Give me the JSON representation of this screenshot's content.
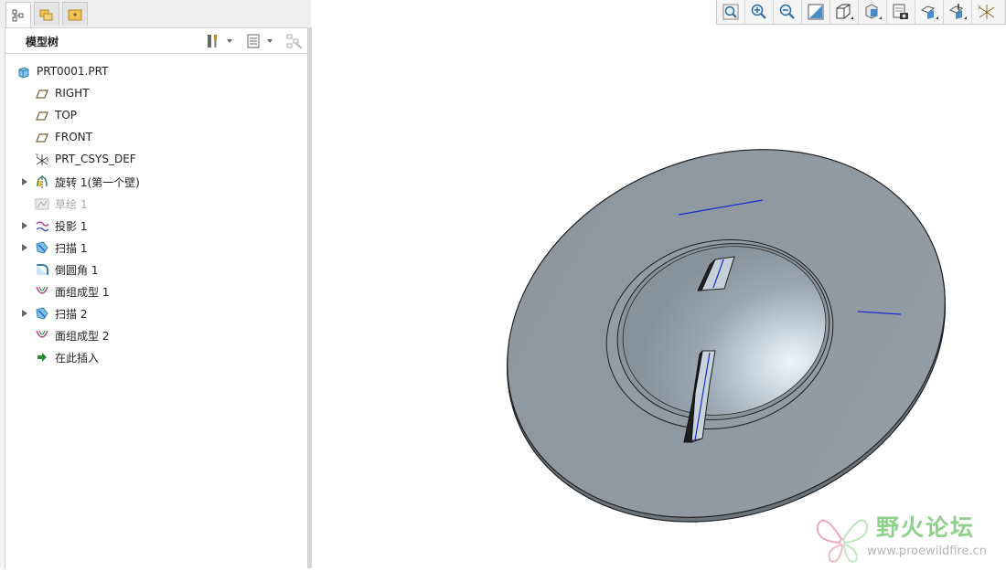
{
  "model_tree": {
    "title": "模型树",
    "items": [
      {
        "label": "PRT0001.PRT",
        "icon": "part-icon",
        "expandable": false,
        "disabled": false,
        "indent": 0
      },
      {
        "label": "RIGHT",
        "icon": "datum-plane-icon",
        "expandable": false,
        "disabled": false,
        "indent": 1
      },
      {
        "label": "TOP",
        "icon": "datum-plane-icon",
        "expandable": false,
        "disabled": false,
        "indent": 1
      },
      {
        "label": "FRONT",
        "icon": "datum-plane-icon",
        "expandable": false,
        "disabled": false,
        "indent": 1
      },
      {
        "label": "PRT_CSYS_DEF",
        "icon": "csys-icon",
        "expandable": false,
        "disabled": false,
        "indent": 1
      },
      {
        "label": "旋转 1(第一个壁)",
        "icon": "revolve-icon",
        "expandable": true,
        "disabled": false,
        "indent": 1
      },
      {
        "label": "草绘 1",
        "icon": "sketch-icon",
        "expandable": false,
        "disabled": true,
        "indent": 1
      },
      {
        "label": "投影 1",
        "icon": "projection-icon",
        "expandable": true,
        "disabled": false,
        "indent": 1
      },
      {
        "label": "扫描 1",
        "icon": "sweep-icon",
        "expandable": true,
        "disabled": false,
        "indent": 1
      },
      {
        "label": "倒圆角 1",
        "icon": "round-icon",
        "expandable": false,
        "disabled": false,
        "indent": 1
      },
      {
        "label": "面组成型 1",
        "icon": "quilt-form-icon",
        "expandable": false,
        "disabled": false,
        "indent": 1
      },
      {
        "label": "扫描 2",
        "icon": "sweep-icon",
        "expandable": true,
        "disabled": false,
        "indent": 1
      },
      {
        "label": "面组成型 2",
        "icon": "quilt-form-icon",
        "expandable": false,
        "disabled": false,
        "indent": 1
      },
      {
        "label": "在此插入",
        "icon": "insert-here-arrow-icon",
        "expandable": false,
        "disabled": false,
        "indent": 1
      }
    ]
  },
  "tabs": [
    {
      "name": "tab-model-tree",
      "icon": "model-tree-icon"
    },
    {
      "name": "tab-folder-browser",
      "icon": "folder-browser-icon"
    },
    {
      "name": "tab-favorites",
      "icon": "favorites-icon"
    }
  ],
  "toolbar": {
    "buttons": [
      "refit-icon",
      "zoom-in-icon",
      "zoom-out-icon",
      "repaint-icon",
      "display-style-icon",
      "saved-orientations-icon",
      "view-manager-icon",
      "datum-display-icon",
      "annotation-display-icon",
      "spin-center-icon"
    ]
  },
  "watermark": {
    "title": "野火论坛",
    "url": "www.proewildfire.cn"
  },
  "colors": {
    "part_fill": "#8d979f",
    "edge": "#202020",
    "curve": "#1a2bd0",
    "watermark_green": "#8fd08a"
  }
}
